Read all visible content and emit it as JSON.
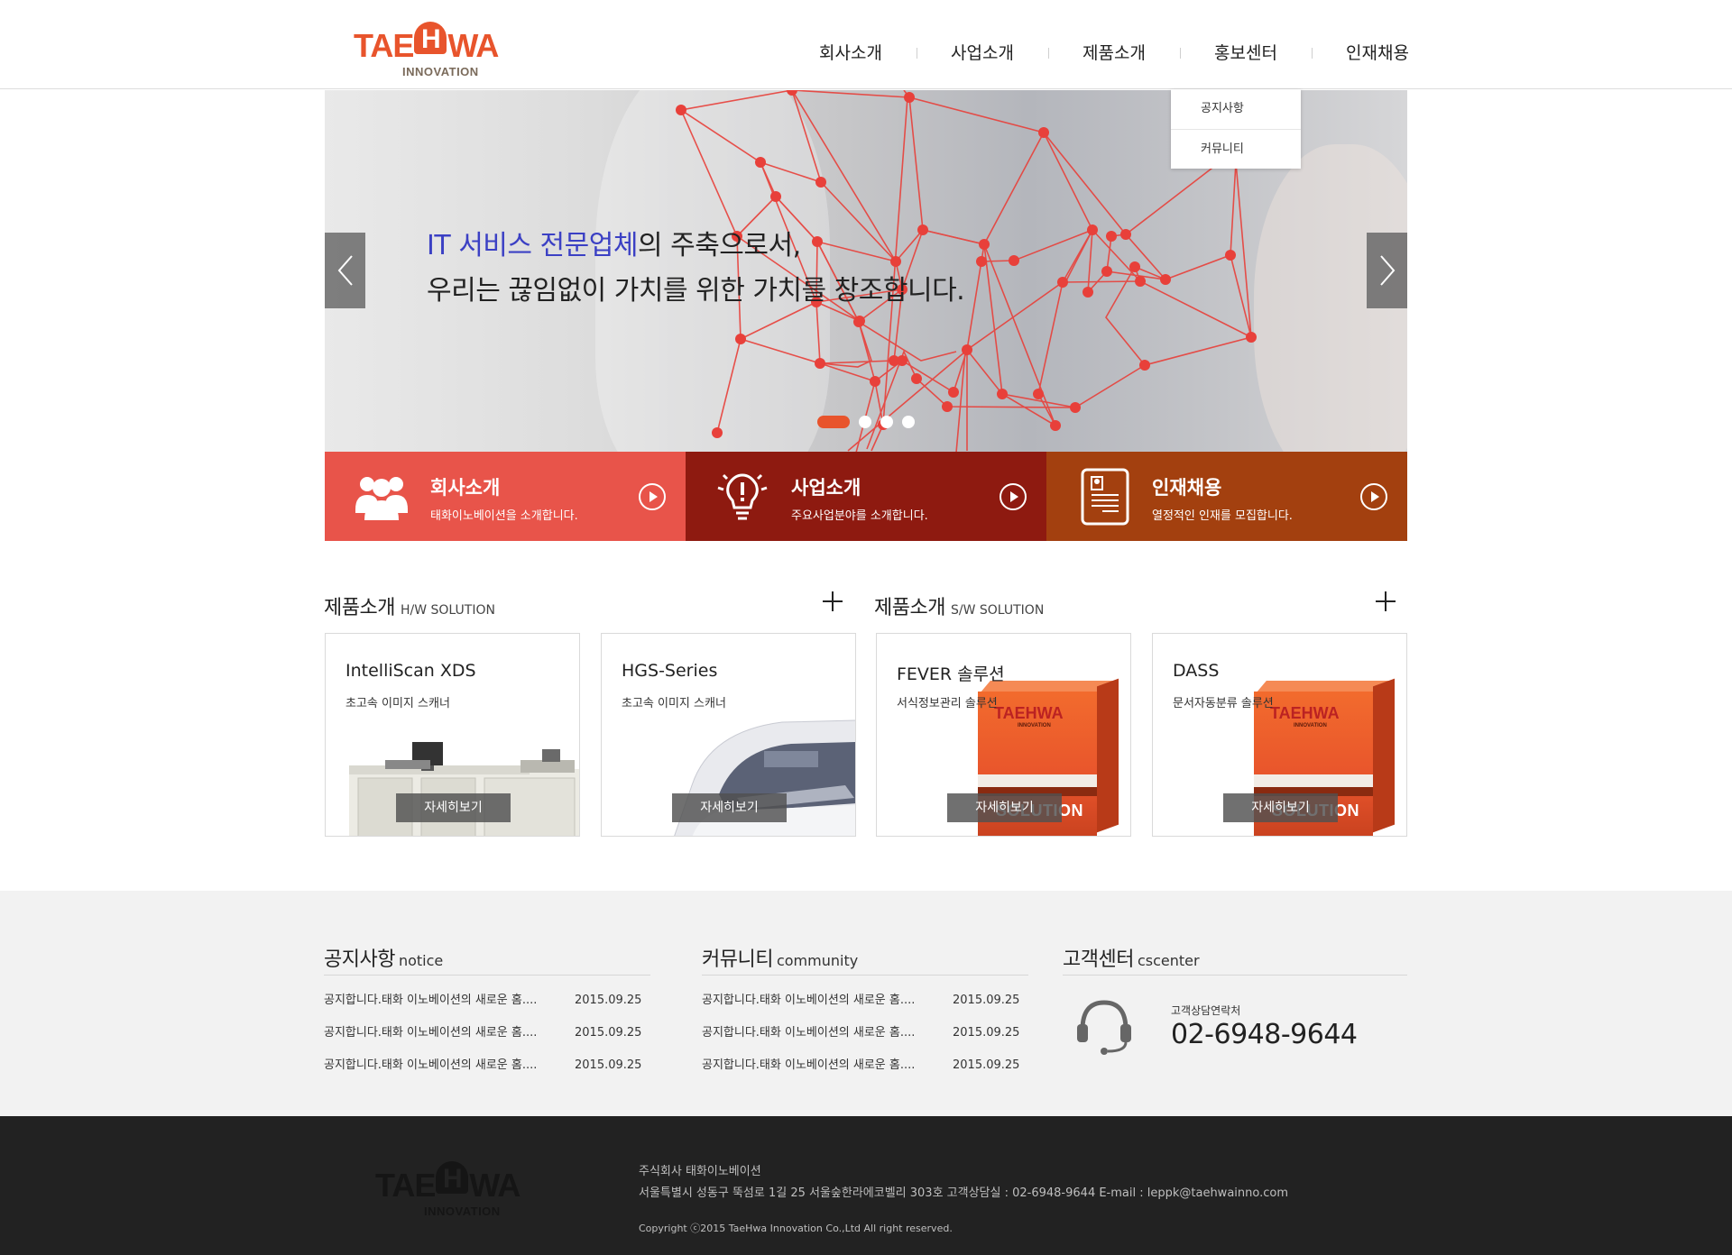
{
  "brand": {
    "logo_left": "TAE",
    "logo_h": "H",
    "logo_right": "WA",
    "logo_sub": "INNOVATION",
    "accent_color": "#e8542c"
  },
  "nav": {
    "items": [
      {
        "label": "회사소개"
      },
      {
        "label": "사업소개"
      },
      {
        "label": "제품소개"
      },
      {
        "label": "홍보센터"
      },
      {
        "label": "인재채용"
      }
    ]
  },
  "dropdown": {
    "items": [
      {
        "label": "공지사항"
      },
      {
        "label": "커뮤니티"
      }
    ]
  },
  "hero": {
    "line1_accent": "IT 서비스 전문업체",
    "line1_rest": "의 주축으로서,",
    "line2": "우리는 끊임없이 가치를 위한 가치를 창조합니다.",
    "slide_count": 4,
    "active_slide": 1,
    "prev_icon": "chevron-left-icon",
    "next_icon": "chevron-right-icon"
  },
  "quick": {
    "items": [
      {
        "title": "회사소개",
        "desc": "태화이노베이션을 소개합니다.",
        "icon": "people-icon",
        "color": "#e8544a"
      },
      {
        "title": "사업소개",
        "desc": "주요사업분야를 소개합니다.",
        "icon": "lightbulb-icon",
        "color": "#8e1a10"
      },
      {
        "title": "인재채용",
        "desc": "열정적인 인재를 모집합니다.",
        "icon": "resume-icon",
        "color": "#a3400f"
      }
    ]
  },
  "products": {
    "hw": {
      "title": "제품소개",
      "sub": "H/W SOLUTION"
    },
    "sw": {
      "title": "제품소개",
      "sub": "S/W SOLUTION"
    },
    "button_label": "자세히보기",
    "box_logo_left": "TAE",
    "box_logo_h": "H",
    "box_logo_right": "WA",
    "box_logo_sub": "INNOVATION",
    "box_label": "SOLUTION",
    "cards": [
      {
        "title": "IntelliScan XDS",
        "desc": "초고속 이미지 스캐너",
        "image": "scanner"
      },
      {
        "title": "HGS-Series",
        "desc": "초고속 이미지 스캐너",
        "image": "scanner"
      },
      {
        "title": "FEVER 솔루션",
        "desc": "서식정보관리 솔루션",
        "image": "software-box"
      },
      {
        "title": "DASS",
        "desc": "문서자동분류 솔루션",
        "image": "software-box"
      }
    ]
  },
  "notice": {
    "title": "공지사항",
    "sub": "notice",
    "rows": [
      {
        "text": "공지합니다.태화 이노베이션의 새로운 홈....",
        "date": "2015.09.25"
      },
      {
        "text": "공지합니다.태화 이노베이션의 새로운 홈....",
        "date": "2015.09.25"
      },
      {
        "text": "공지합니다.태화 이노베이션의 새로운 홈....",
        "date": "2015.09.25"
      }
    ]
  },
  "community": {
    "title": "커뮤니티",
    "sub": "community",
    "rows": [
      {
        "text": "공지합니다.태화 이노베이션의 새로운 홈....",
        "date": "2015.09.25"
      },
      {
        "text": "공지합니다.태화 이노베이션의 새로운 홈....",
        "date": "2015.09.25"
      },
      {
        "text": "공지합니다.태화 이노베이션의 새로운 홈....",
        "date": "2015.09.25"
      }
    ]
  },
  "cscenter": {
    "title": "고객센터",
    "sub": "cscenter",
    "label": "고객상담연락처",
    "phone": "02-6948-9644",
    "icon": "headset-icon"
  },
  "footer": {
    "company": "주식회사 태화이노베이션",
    "address": "서울특별시 성동구 뚝섬로 1길 25 서울숲한라에코벨리 303호    고객상담실 : 02-6948-9644    E-mail : leppk@taehwainno.com",
    "copyright": "Copyright ⓒ2015 TaeHwa Innovation Co.,Ltd All right reserved."
  }
}
